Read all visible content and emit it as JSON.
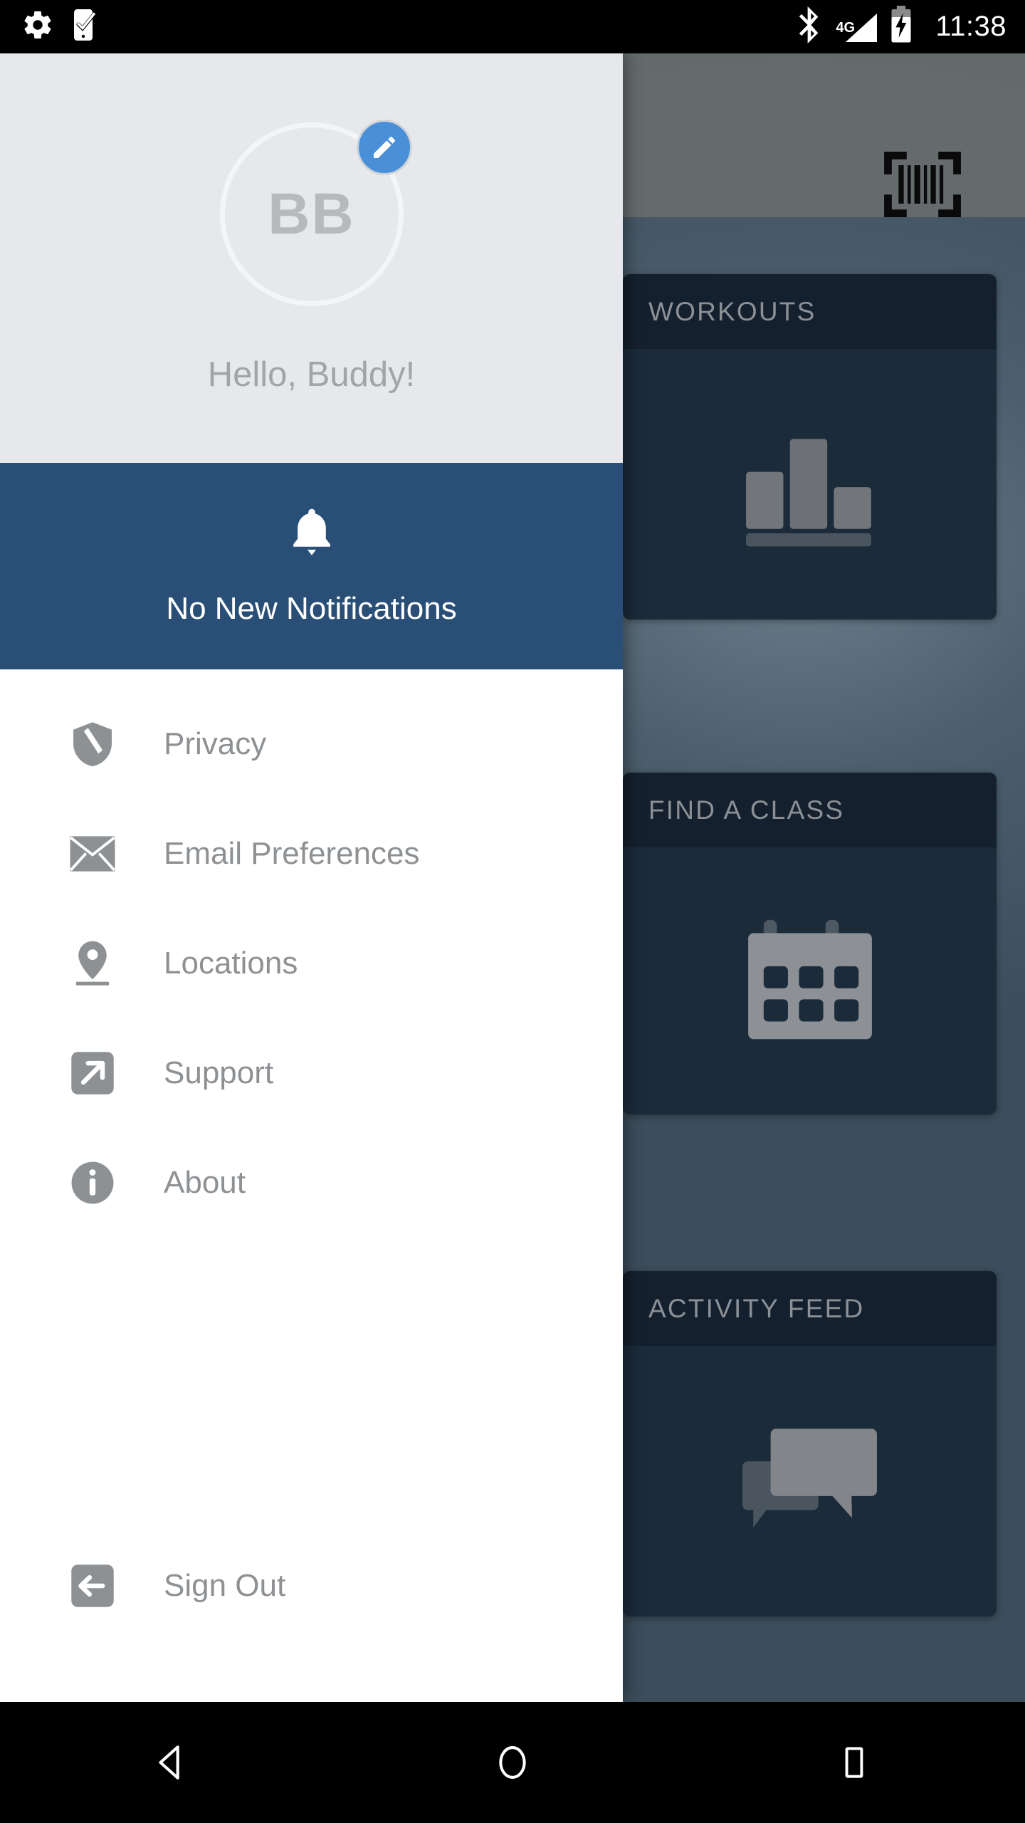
{
  "status_bar": {
    "icons": [
      "settings-gear-icon",
      "phone-check-icon",
      "bluetooth-icon",
      "signal-icon",
      "battery-charging-icon"
    ],
    "network": "4G",
    "time": "11:38"
  },
  "app_bar": {
    "scan_icon": "barcode-scan-icon"
  },
  "background_cards": [
    {
      "title": "WORKOUTS",
      "icon": "bar-chart-icon"
    },
    {
      "title": "FIND A CLASS",
      "icon": "calendar-icon"
    },
    {
      "title": "ACTIVITY FEED",
      "icon": "chat-bubbles-icon"
    }
  ],
  "drawer": {
    "avatar": {
      "initials": "BB",
      "edit_badge_icon": "pencil-edit-icon"
    },
    "greeting": "Hello, Buddy!",
    "notification": {
      "icon": "bell-icon",
      "text": "No New Notifications"
    },
    "menu_items": [
      {
        "label": "Privacy",
        "icon": "shield-privacy-icon"
      },
      {
        "label": "Email Preferences",
        "icon": "envelope-icon"
      },
      {
        "label": "Locations",
        "icon": "map-pin-icon"
      },
      {
        "label": "Support",
        "icon": "external-link-icon"
      },
      {
        "label": "About",
        "icon": "info-circle-icon"
      }
    ],
    "sign_out": {
      "label": "Sign Out",
      "icon": "sign-out-arrow-icon"
    }
  },
  "nav_bar": {
    "back": "back-triangle-icon",
    "home": "home-circle-icon",
    "recents": "recents-square-icon"
  },
  "colors": {
    "drawer_header_bg": "#e6e8eb",
    "notification_bg": "#2a4f76",
    "card_header_bg": "#14202d",
    "card_body_bg": "#1b2b3a",
    "accent_blue": "#4a90d9",
    "menu_text": "#8e9194"
  }
}
